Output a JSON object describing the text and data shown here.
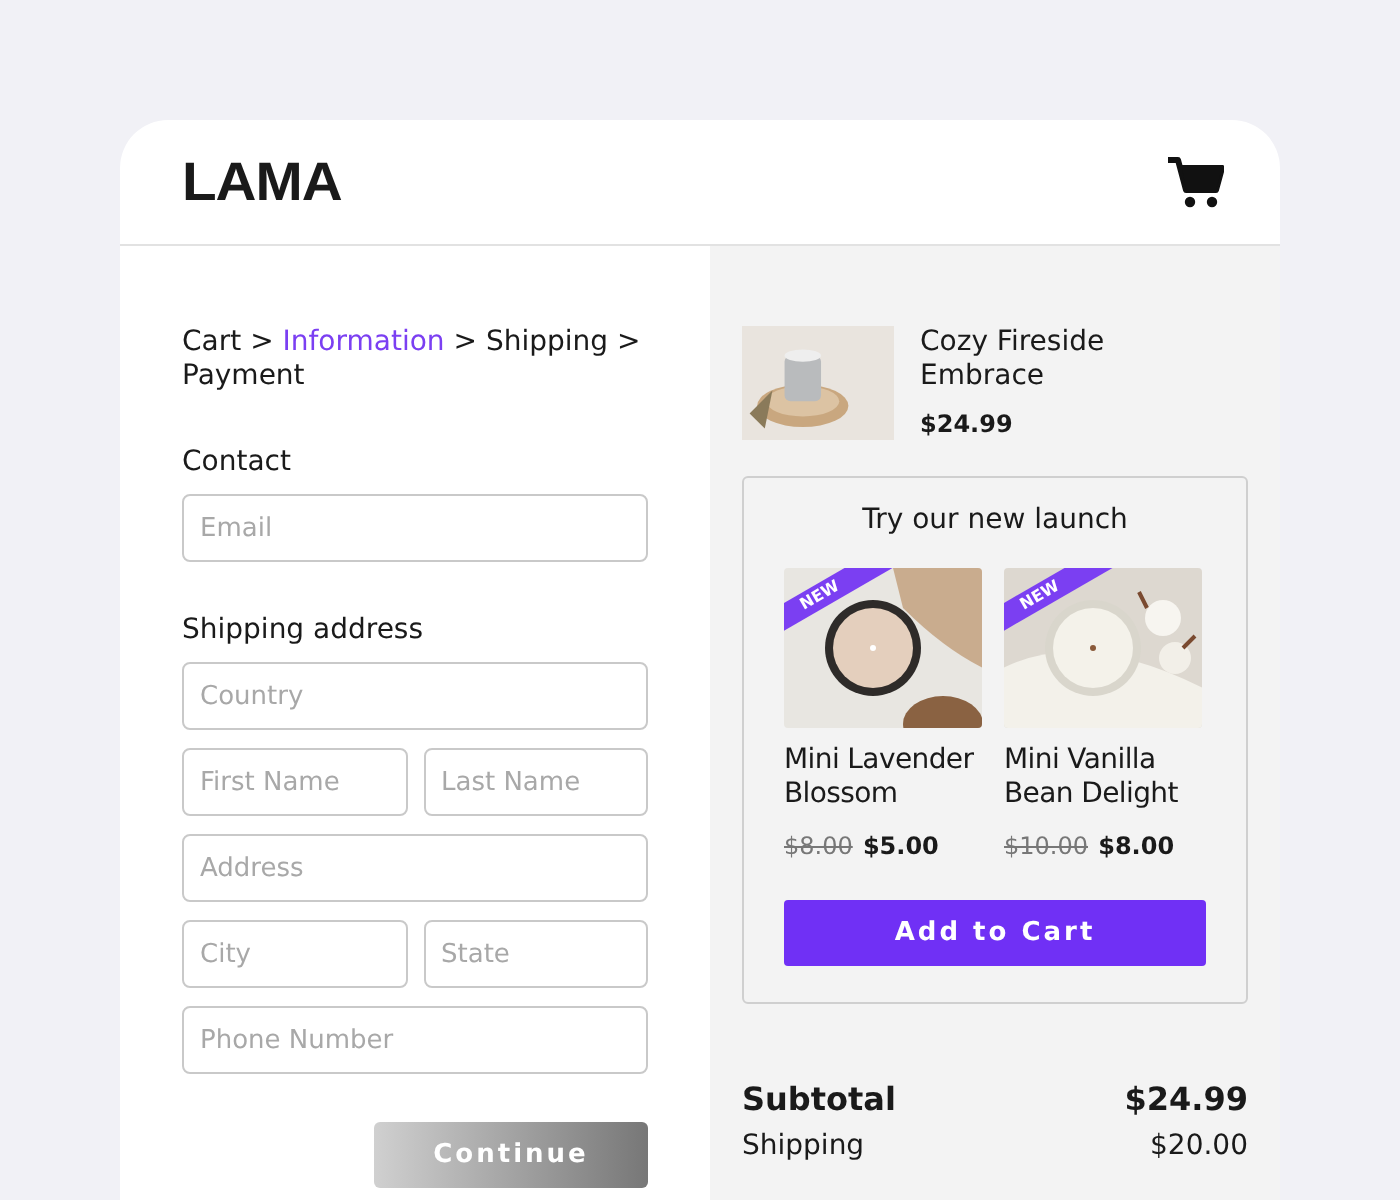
{
  "header": {
    "logo": "LAMA"
  },
  "breadcrumb": [
    {
      "label": "Cart",
      "selected": false
    },
    {
      "label": "Information",
      "selected": true
    },
    {
      "label": "Shipping",
      "selected": false
    },
    {
      "label": "Payment",
      "selected": false
    }
  ],
  "breadcrumb_separator": ">",
  "contact": {
    "title": "Contact",
    "fields": [
      [
        {
          "placeholder": "Email"
        }
      ]
    ]
  },
  "shipping": {
    "title": "Shipping address",
    "fields": [
      [
        {
          "placeholder": "Country"
        }
      ],
      [
        {
          "placeholder": "First Name"
        },
        {
          "placeholder": "Last Name"
        }
      ],
      [
        {
          "placeholder": "Address"
        }
      ],
      [
        {
          "placeholder": "City"
        },
        {
          "placeholder": "State"
        }
      ],
      [
        {
          "placeholder": "Phone Number"
        }
      ]
    ]
  },
  "continue_button": "Continue",
  "cart_item": {
    "name": "Cozy Fireside Embrace",
    "price": "$24.99"
  },
  "launch": {
    "title": "Try our new launch",
    "products": [
      {
        "badge": "NEW",
        "name": "Mini Lavender Blossom",
        "old_price": "$8.00",
        "price": "$5.00",
        "kind": "picture"
      },
      {
        "badge": "NEW",
        "name": "Mini Vanilla Bean Delight",
        "old_price": "$10.00",
        "price": "$8.00",
        "kind": "picture"
      }
    ],
    "button": "Add to Cart"
  },
  "totals": [
    {
      "label": "Subtotal",
      "value": "$24.99",
      "kind": "strong"
    },
    {
      "label": "Shipping",
      "value": "$20.00",
      "kind": "normal"
    }
  ]
}
